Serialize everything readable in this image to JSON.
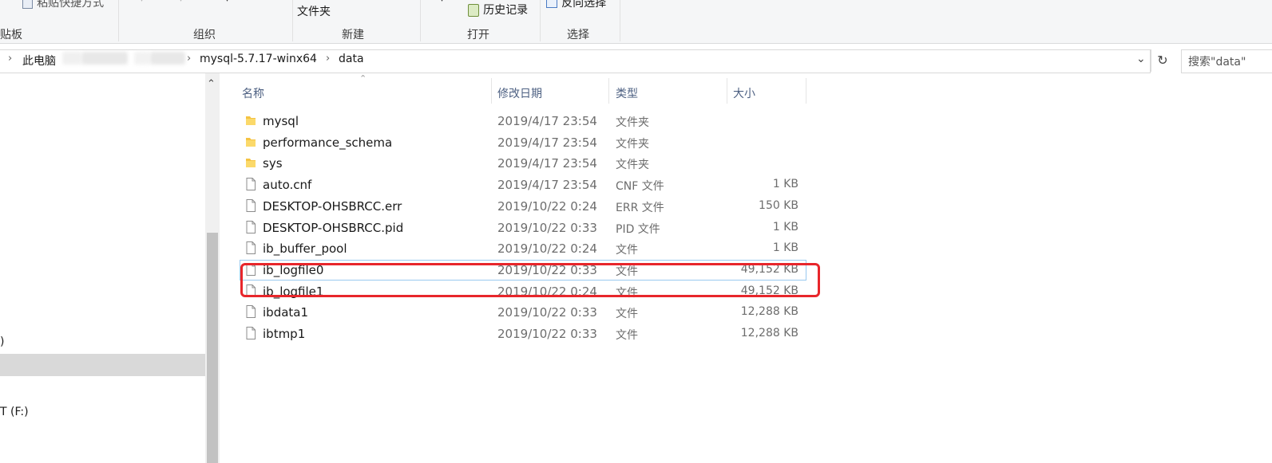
{
  "ribbon": {
    "clipboard_item": "粘贴快捷方式",
    "clipboard_label": "贴板",
    "organize_label": "组织",
    "new_item": "文件夹",
    "new_label": "新建",
    "open_item": "历史记录",
    "open_label": "打开",
    "select_item": "反向选择",
    "select_label": "选择"
  },
  "address": {
    "this_pc": "此电脑",
    "folder": "mysql-5.7.17-winx64",
    "current": "data",
    "search_placeholder": "搜索\"data\""
  },
  "nav": {
    "item_paren": ")",
    "item_drive": "T (F:)"
  },
  "columns": {
    "name": "名称",
    "modified": "修改日期",
    "type": "类型",
    "size": "大小"
  },
  "files": [
    {
      "name": "mysql",
      "date": "2019/4/17 23:54",
      "type": "文件夹",
      "size": "",
      "icon": "folder-icon"
    },
    {
      "name": "performance_schema",
      "date": "2019/4/17 23:54",
      "type": "文件夹",
      "size": "",
      "icon": "folder-icon"
    },
    {
      "name": "sys",
      "date": "2019/4/17 23:54",
      "type": "文件夹",
      "size": "",
      "icon": "folder-icon"
    },
    {
      "name": "auto.cnf",
      "date": "2019/4/17 23:54",
      "type": "CNF 文件",
      "size": "1 KB",
      "icon": "file-icon"
    },
    {
      "name": "DESKTOP-OHSBRCC.err",
      "date": "2019/10/22 0:24",
      "type": "ERR 文件",
      "size": "150 KB",
      "icon": "file-icon"
    },
    {
      "name": "DESKTOP-OHSBRCC.pid",
      "date": "2019/10/22 0:33",
      "type": "PID 文件",
      "size": "1 KB",
      "icon": "file-icon"
    },
    {
      "name": "ib_buffer_pool",
      "date": "2019/10/22 0:24",
      "type": "文件",
      "size": "1 KB",
      "icon": "file-icon"
    },
    {
      "name": "ib_logfile0",
      "date": "2019/10/22 0:33",
      "type": "文件",
      "size": "49,152 KB",
      "icon": "file-icon"
    },
    {
      "name": "ib_logfile1",
      "date": "2019/10/22 0:24",
      "type": "文件",
      "size": "49,152 KB",
      "icon": "file-icon"
    },
    {
      "name": "ibdata1",
      "date": "2019/10/22 0:33",
      "type": "文件",
      "size": "12,288 KB",
      "icon": "file-icon"
    },
    {
      "name": "ibtmp1",
      "date": "2019/10/22 0:33",
      "type": "文件",
      "size": "12,288 KB",
      "icon": "file-icon"
    }
  ],
  "colors": {
    "highlight": "#e8262b",
    "folder": "#f5c342",
    "header_text": "#4d6082"
  }
}
